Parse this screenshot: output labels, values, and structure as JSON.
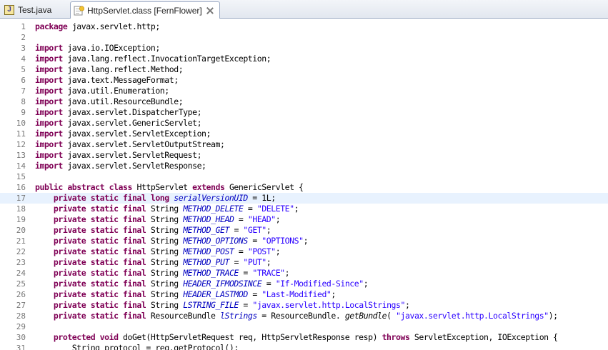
{
  "tabs": [
    {
      "label": "Test.java",
      "icon": "java-file-icon",
      "active": false
    },
    {
      "label": "HttpServlet.class [FernFlower]",
      "icon": "class-file-icon",
      "active": true
    }
  ],
  "editor": {
    "current_line": 17,
    "colors": {
      "keyword": "#7f0055",
      "string": "#2a00ff",
      "field": "#0000c0",
      "line_number": "#787878",
      "current_line_bg": "#e8f2fe"
    },
    "lines": [
      {
        "n": "1",
        "t": [
          [
            "kw",
            "package"
          ],
          [
            "",
            "javax.servlet.http;"
          ]
        ]
      },
      {
        "n": "2",
        "t": []
      },
      {
        "n": "3",
        "t": [
          [
            "kw",
            "import"
          ],
          [
            "",
            "java.io.IOException;"
          ]
        ]
      },
      {
        "n": "4",
        "t": [
          [
            "kw",
            "import"
          ],
          [
            "",
            "java.lang.reflect.InvocationTargetException;"
          ]
        ]
      },
      {
        "n": "5",
        "t": [
          [
            "kw",
            "import"
          ],
          [
            "",
            "java.lang.reflect.Method;"
          ]
        ]
      },
      {
        "n": "6",
        "t": [
          [
            "kw",
            "import"
          ],
          [
            "",
            "java.text.MessageFormat;"
          ]
        ]
      },
      {
        "n": "7",
        "t": [
          [
            "kw",
            "import"
          ],
          [
            "",
            "java.util.Enumeration;"
          ]
        ]
      },
      {
        "n": "8",
        "t": [
          [
            "kw",
            "import"
          ],
          [
            "",
            "java.util.ResourceBundle;"
          ]
        ]
      },
      {
        "n": "9",
        "t": [
          [
            "kw",
            "import"
          ],
          [
            "",
            "javax.servlet.DispatcherType;"
          ]
        ]
      },
      {
        "n": "10",
        "t": [
          [
            "kw",
            "import"
          ],
          [
            "",
            "javax.servlet.GenericServlet;"
          ]
        ]
      },
      {
        "n": "11",
        "t": [
          [
            "kw",
            "import"
          ],
          [
            "",
            "javax.servlet.ServletException;"
          ]
        ]
      },
      {
        "n": "12",
        "t": [
          [
            "kw",
            "import"
          ],
          [
            "",
            "javax.servlet.ServletOutputStream;"
          ]
        ]
      },
      {
        "n": "13",
        "t": [
          [
            "kw",
            "import"
          ],
          [
            "",
            "javax.servlet.ServletRequest;"
          ]
        ]
      },
      {
        "n": "14",
        "t": [
          [
            "kw",
            "import"
          ],
          [
            "",
            "javax.servlet.ServletResponse;"
          ]
        ]
      },
      {
        "n": "15",
        "t": []
      },
      {
        "n": "16",
        "t": [
          [
            "kw",
            "public abstract class"
          ],
          [
            "",
            "HttpServlet"
          ],
          [
            "kw",
            "extends"
          ],
          [
            "",
            "GenericServlet {"
          ]
        ]
      },
      {
        "n": "17",
        "t": [
          [
            "i",
            "    "
          ],
          [
            "kw",
            "private static final long"
          ],
          [
            "fld",
            "serialVersionUID"
          ],
          [
            "",
            "= 1L;"
          ]
        ]
      },
      {
        "n": "18",
        "t": [
          [
            "i",
            "    "
          ],
          [
            "kw",
            "private static final"
          ],
          [
            "",
            "String"
          ],
          [
            "fld",
            "METHOD_DELETE"
          ],
          [
            "",
            "="
          ],
          [
            "str",
            "\"DELETE\""
          ],
          [
            "p",
            ";"
          ]
        ]
      },
      {
        "n": "19",
        "t": [
          [
            "i",
            "    "
          ],
          [
            "kw",
            "private static final"
          ],
          [
            "",
            "String"
          ],
          [
            "fld",
            "METHOD_HEAD"
          ],
          [
            "",
            "="
          ],
          [
            "str",
            "\"HEAD\""
          ],
          [
            "p",
            ";"
          ]
        ]
      },
      {
        "n": "20",
        "t": [
          [
            "i",
            "    "
          ],
          [
            "kw",
            "private static final"
          ],
          [
            "",
            "String"
          ],
          [
            "fld",
            "METHOD_GET"
          ],
          [
            "",
            "="
          ],
          [
            "str",
            "\"GET\""
          ],
          [
            "p",
            ";"
          ]
        ]
      },
      {
        "n": "21",
        "t": [
          [
            "i",
            "    "
          ],
          [
            "kw",
            "private static final"
          ],
          [
            "",
            "String"
          ],
          [
            "fld",
            "METHOD_OPTIONS"
          ],
          [
            "",
            "="
          ],
          [
            "str",
            "\"OPTIONS\""
          ],
          [
            "p",
            ";"
          ]
        ]
      },
      {
        "n": "22",
        "t": [
          [
            "i",
            "    "
          ],
          [
            "kw",
            "private static final"
          ],
          [
            "",
            "String"
          ],
          [
            "fld",
            "METHOD_POST"
          ],
          [
            "",
            "="
          ],
          [
            "str",
            "\"POST\""
          ],
          [
            "p",
            ";"
          ]
        ]
      },
      {
        "n": "23",
        "t": [
          [
            "i",
            "    "
          ],
          [
            "kw",
            "private static final"
          ],
          [
            "",
            "String"
          ],
          [
            "fld",
            "METHOD_PUT"
          ],
          [
            "",
            "="
          ],
          [
            "str",
            "\"PUT\""
          ],
          [
            "p",
            ";"
          ]
        ]
      },
      {
        "n": "24",
        "t": [
          [
            "i",
            "    "
          ],
          [
            "kw",
            "private static final"
          ],
          [
            "",
            "String"
          ],
          [
            "fld",
            "METHOD_TRACE"
          ],
          [
            "",
            "="
          ],
          [
            "str",
            "\"TRACE\""
          ],
          [
            "p",
            ";"
          ]
        ]
      },
      {
        "n": "25",
        "t": [
          [
            "i",
            "    "
          ],
          [
            "kw",
            "private static final"
          ],
          [
            "",
            "String"
          ],
          [
            "fld",
            "HEADER_IFMODSINCE"
          ],
          [
            "",
            "="
          ],
          [
            "str",
            "\"If-Modified-Since\""
          ],
          [
            "p",
            ";"
          ]
        ]
      },
      {
        "n": "26",
        "t": [
          [
            "i",
            "    "
          ],
          [
            "kw",
            "private static final"
          ],
          [
            "",
            "String"
          ],
          [
            "fld",
            "HEADER_LASTMOD"
          ],
          [
            "",
            "="
          ],
          [
            "str",
            "\"Last-Modified\""
          ],
          [
            "p",
            ";"
          ]
        ]
      },
      {
        "n": "27",
        "t": [
          [
            "i",
            "    "
          ],
          [
            "kw",
            "private static final"
          ],
          [
            "",
            "String"
          ],
          [
            "fld",
            "LSTRING_FILE"
          ],
          [
            "",
            "="
          ],
          [
            "str",
            "\"javax.servlet.http.LocalStrings\""
          ],
          [
            "p",
            ";"
          ]
        ]
      },
      {
        "n": "28",
        "t": [
          [
            "i",
            "    "
          ],
          [
            "kw",
            "private static final"
          ],
          [
            "",
            "ResourceBundle"
          ],
          [
            "fld",
            "lStrings"
          ],
          [
            "",
            "= ResourceBundle."
          ],
          [
            "mth",
            "getBundle"
          ],
          [
            "p",
            "("
          ],
          [
            "str",
            "\"javax.servlet.http.LocalStrings\""
          ],
          [
            "p",
            ");"
          ]
        ]
      },
      {
        "n": "29",
        "t": []
      },
      {
        "n": "30",
        "t": [
          [
            "i",
            "    "
          ],
          [
            "kw",
            "protected void"
          ],
          [
            "",
            "doGet(HttpServletRequest req, HttpServletResponse resp)"
          ],
          [
            "kw",
            "throws"
          ],
          [
            "",
            "ServletException, IOException {"
          ]
        ]
      },
      {
        "n": "31",
        "t": [
          [
            "i",
            "        "
          ],
          [
            "",
            "String protocol = req.getProtocol();"
          ]
        ]
      }
    ]
  }
}
